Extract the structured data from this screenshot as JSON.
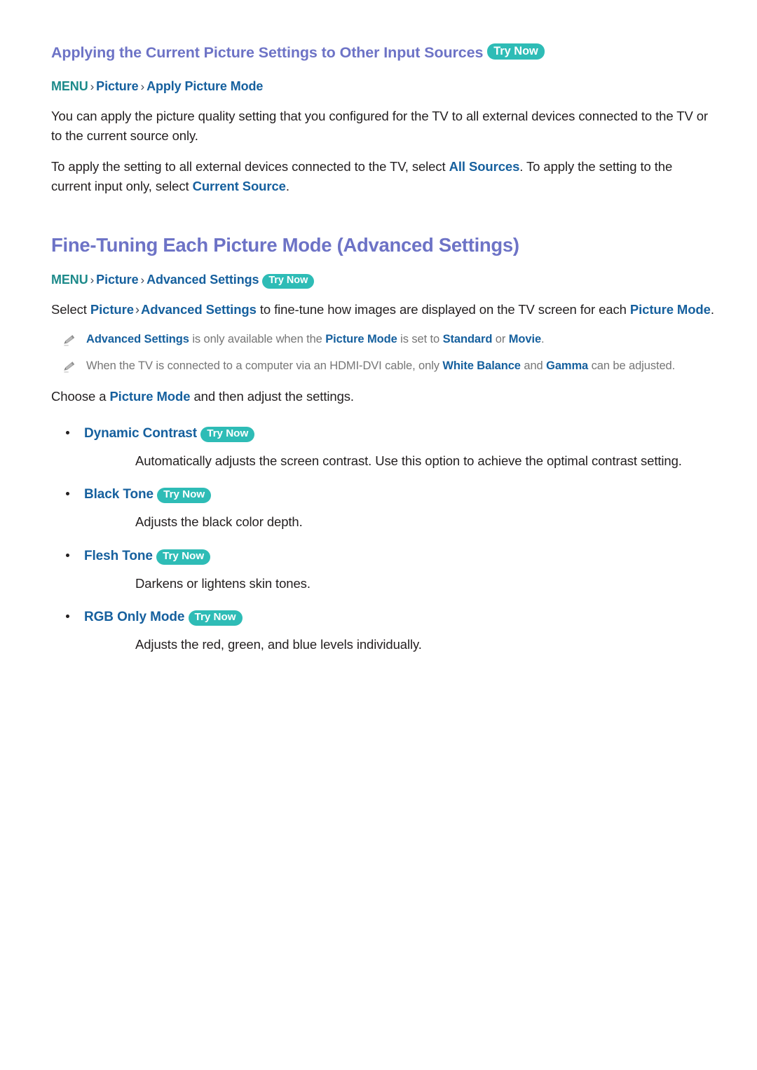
{
  "document": {
    "section_one": {
      "heading": "Applying the Current Picture Settings to Other Input Sources",
      "heading_badge": "Try Now",
      "breadcrumb": {
        "menu": "MENU",
        "separator": "›",
        "items": [
          "Picture",
          "Apply Picture Mode"
        ]
      },
      "paragraph_1": "You can apply the picture quality setting that you configured for the TV to all external devices connected to the TV or to the current source only.",
      "paragraph_2": {
        "part_1": "To apply the setting to all external devices connected to the TV, select ",
        "term_1": "All Sources",
        "part_2": ". To apply the setting to the current input only, select ",
        "term_2": "Current Source",
        "part_3": "."
      }
    },
    "section_two": {
      "heading": "Fine-Tuning Each Picture Mode (Advanced Settings)",
      "breadcrumb": {
        "menu": "MENU",
        "separator": "›",
        "items": [
          "Picture",
          "Advanced Settings"
        ],
        "badge": "Try Now"
      },
      "intro": {
        "part_1": "Select ",
        "term_1": "Picture",
        "separator": "›",
        "term_2": "Advanced Settings",
        "part_2": " to fine-tune how images are displayed on the TV screen for each ",
        "term_3": "Picture Mode",
        "part_3": "."
      },
      "notes": [
        {
          "icon": "pencil-icon",
          "part_1": "",
          "term_1": "Advanced Settings",
          "part_2": " is only available when the ",
          "term_2": "Picture Mode",
          "part_3": " is set to ",
          "term_3": "Standard",
          "part_4": " or ",
          "term_4": "Movie",
          "part_5": "."
        },
        {
          "icon": "pencil-icon",
          "part_1": "When the TV is connected to a computer via an HDMI-DVI cable, only ",
          "term_1": "White Balance",
          "part_2": " and ",
          "term_2": "Gamma",
          "part_3": " can be adjusted.",
          "part_4": "",
          "term_3": "",
          "term_4": "",
          "part_5": ""
        }
      ],
      "choose_line": {
        "part_1": "Choose a ",
        "term_1": "Picture Mode",
        "part_2": " and then adjust the settings."
      },
      "options": [
        {
          "label": "Dynamic Contrast",
          "badge": "Try Now",
          "description": "Automatically adjusts the screen contrast. Use this option to achieve the optimal contrast setting."
        },
        {
          "label": "Black Tone",
          "badge": "Try Now",
          "description": "Adjusts the black color depth."
        },
        {
          "label": "Flesh Tone",
          "badge": "Try Now",
          "description": "Darkens or lightens skin tones."
        },
        {
          "label": "RGB Only Mode",
          "badge": "Try Now",
          "description": "Adjusts the red, green, and blue levels individually."
        }
      ]
    }
  },
  "colors": {
    "heading_purple": "#6d73c6",
    "link_blue": "#16609e",
    "menu_teal": "#1d8a8a",
    "badge_teal": "#2ebcb6",
    "body_black": "#231f20",
    "note_gray": "#767676"
  }
}
